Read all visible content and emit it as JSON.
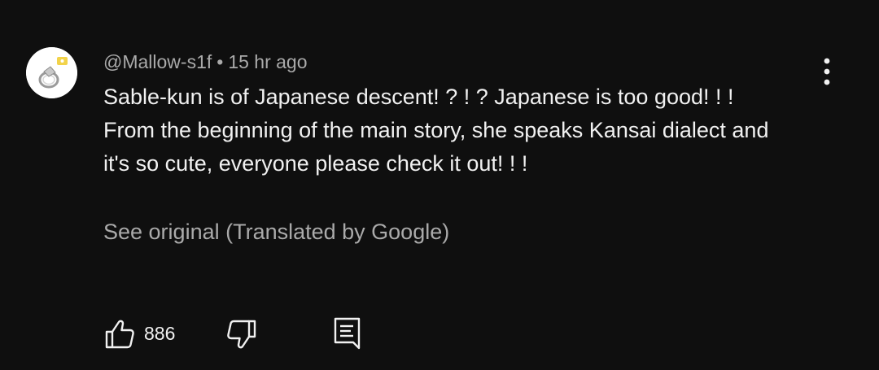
{
  "comment": {
    "author": "@Mallow-s1f",
    "separator": "•",
    "timestamp": "15 hr ago",
    "text_lines": [
      "Sable-kun is of Japanese descent! ? ! ? Japanese is too good! ! !",
      "From the beginning of the main story, she speaks Kansai dialect and",
      "it's so cute, everyone please check it out! ! !"
    ],
    "see_original_label": "See original (Translated by Google)",
    "like_count": "886"
  },
  "icons": {
    "avatar": "avatar-image",
    "more": "vertical-dots-icon",
    "like": "thumbs-up-icon",
    "dislike": "thumbs-down-icon",
    "reply": "comment-reply-icon"
  },
  "colors": {
    "background": "#0f0f0f",
    "primary_text": "#f1f1f1",
    "secondary_text": "#aaaaaa"
  }
}
